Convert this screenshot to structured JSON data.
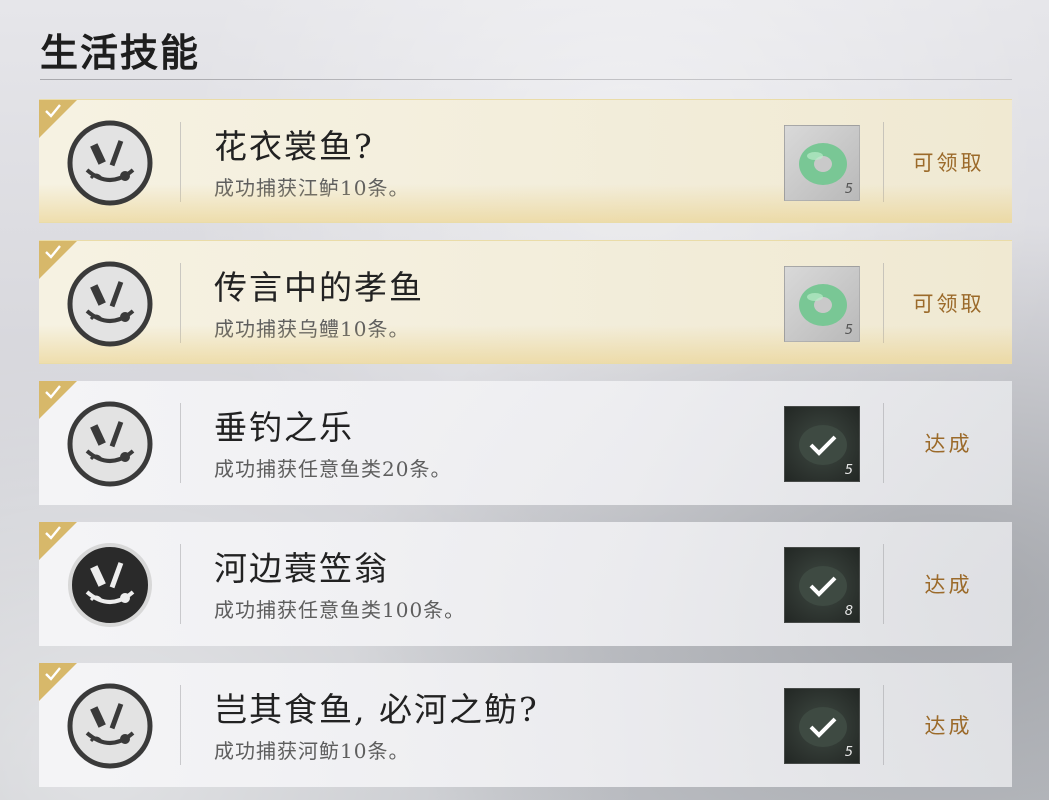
{
  "page": {
    "title": "生活技能"
  },
  "colors": {
    "gold_corner": "#d7b86a",
    "action_text": "#9b6a2a",
    "jade": "#6fbf8a"
  },
  "achievements": [
    {
      "name": "花衣裳鱼?",
      "description": "成功捕获江鲈10条。",
      "action": "可领取",
      "reward_count": "5",
      "reward_icon": "jade-ring-icon",
      "state": "claimable"
    },
    {
      "name": "传言中的孝鱼",
      "description": "成功捕获乌鳢10条。",
      "action": "可领取",
      "reward_count": "5",
      "reward_icon": "jade-ring-icon",
      "state": "claimable"
    },
    {
      "name": "垂钓之乐",
      "description": "成功捕获任意鱼类20条。",
      "action": "达成",
      "reward_count": "5",
      "reward_icon": "claimed-check-icon",
      "state": "achieved"
    },
    {
      "name": "河边蓑笠翁",
      "description": "成功捕获任意鱼类100条。",
      "action": "达成",
      "reward_count": "8",
      "reward_icon": "claimed-check-icon",
      "state": "achieved"
    },
    {
      "name": "岂其食鱼, 必河之鲂?",
      "description": "成功捕获河鲂10条。",
      "action": "达成",
      "reward_count": "5",
      "reward_icon": "claimed-check-icon",
      "state": "achieved"
    }
  ]
}
